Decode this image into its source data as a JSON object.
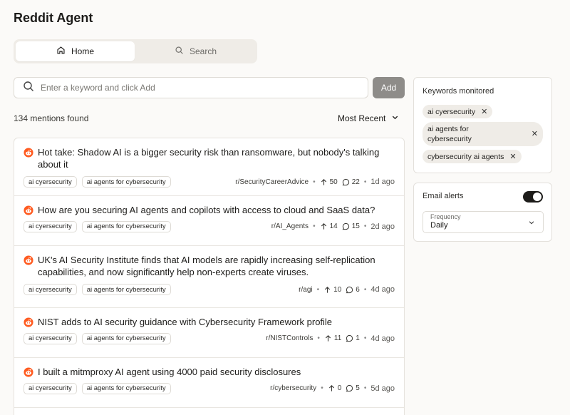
{
  "app": {
    "title": "Reddit Agent"
  },
  "tabs": [
    {
      "label": "Home",
      "icon": "home-icon",
      "active": true
    },
    {
      "label": "Search",
      "icon": "search-icon",
      "active": false
    }
  ],
  "keyword_input": {
    "placeholder": "Enter a keyword and click Add",
    "value": ""
  },
  "add_button": {
    "label": "Add"
  },
  "results": {
    "count_text": "134 mentions found",
    "sort_label": "Most Recent"
  },
  "posts": [
    {
      "title": "Hot take: Shadow AI is a bigger security risk than ransomware, but nobody's talking about it",
      "tags": [
        "ai cyersecurity",
        "ai agents for cybersecurity"
      ],
      "subreddit": "r/SecurityCareerAdvice",
      "upvotes": "50",
      "comments": "22",
      "age": "1d ago"
    },
    {
      "title": "How are you securing AI agents and copilots with access to cloud and SaaS data?",
      "tags": [
        "ai cyersecurity",
        "ai agents for cybersecurity"
      ],
      "subreddit": "r/AI_Agents",
      "upvotes": "14",
      "comments": "15",
      "age": "2d ago"
    },
    {
      "title": "UK's AI Security Institute finds that AI models are rapidly increasing self-replication capabilities, and now significantly help non-experts create viruses.",
      "tags": [
        "ai cyersecurity",
        "ai agents for cybersecurity"
      ],
      "subreddit": "r/agi",
      "upvotes": "10",
      "comments": "6",
      "age": "4d ago"
    },
    {
      "title": "NIST adds to AI security guidance with Cybersecurity Framework profile",
      "tags": [
        "ai cyersecurity",
        "ai agents for cybersecurity"
      ],
      "subreddit": "r/NISTControls",
      "upvotes": "11",
      "comments": "1",
      "age": "4d ago"
    },
    {
      "title": "I built a mitmproxy AI agent using 4000 paid security disclosures",
      "tags": [
        "ai cyersecurity",
        "ai agents for cybersecurity"
      ],
      "subreddit": "r/cybersecurity",
      "upvotes": "0",
      "comments": "5",
      "age": "5d ago"
    }
  ],
  "keywords_panel": {
    "title": "Keywords monitored",
    "keywords": [
      "ai cyersecurity",
      "ai agents for cybersecurity",
      "cybersecurity ai agents"
    ]
  },
  "alerts_panel": {
    "label": "Email alerts",
    "enabled": true,
    "frequency_label": "Frequency",
    "frequency_value": "Daily"
  },
  "colors": {
    "accent_reddit": "#ff4500",
    "add_button_bg": "#8e8c89",
    "toggle_on": "#1d1c1a"
  }
}
